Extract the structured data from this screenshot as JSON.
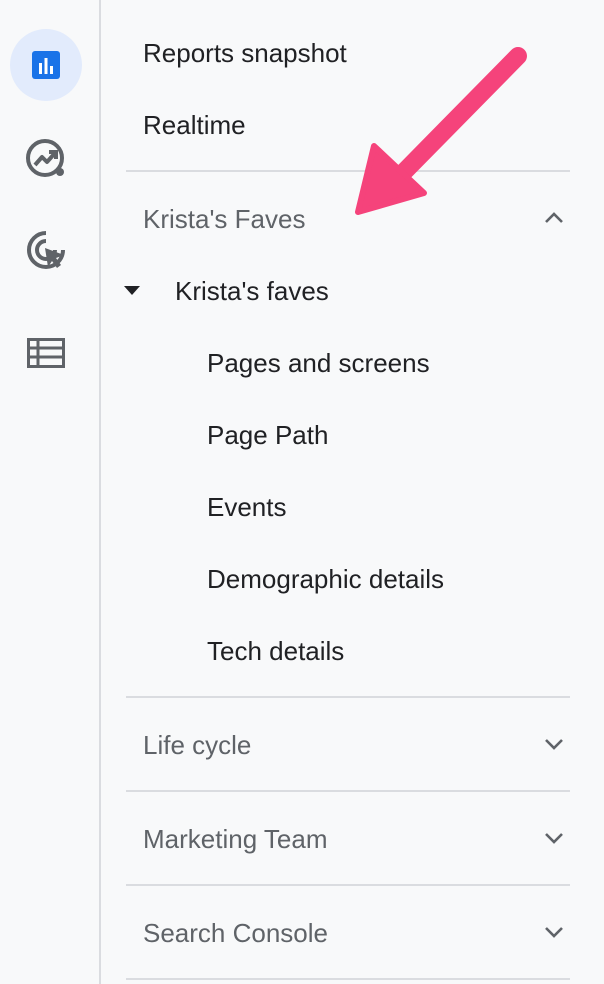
{
  "rail": {
    "icons": [
      "reports-icon",
      "explore-icon",
      "advertising-icon",
      "configure-icon"
    ],
    "accent": "#1a73e8",
    "icon_color": "#5f6368",
    "active_bg": "#e2ebfc"
  },
  "nav": {
    "reports_snapshot": "Reports snapshot",
    "realtime": "Realtime"
  },
  "sections": {
    "kristas_faves": {
      "title": "Krista's Faves",
      "collection": "Krista's faves",
      "items": [
        "Pages and screens",
        "Page Path",
        "Events",
        "Demographic details",
        "Tech details"
      ]
    },
    "life_cycle": {
      "title": "Life cycle"
    },
    "marketing_team": {
      "title": "Marketing Team"
    },
    "search_console": {
      "title": "Search Console"
    }
  },
  "annotation": {
    "arrow_color": "#f5437b"
  }
}
